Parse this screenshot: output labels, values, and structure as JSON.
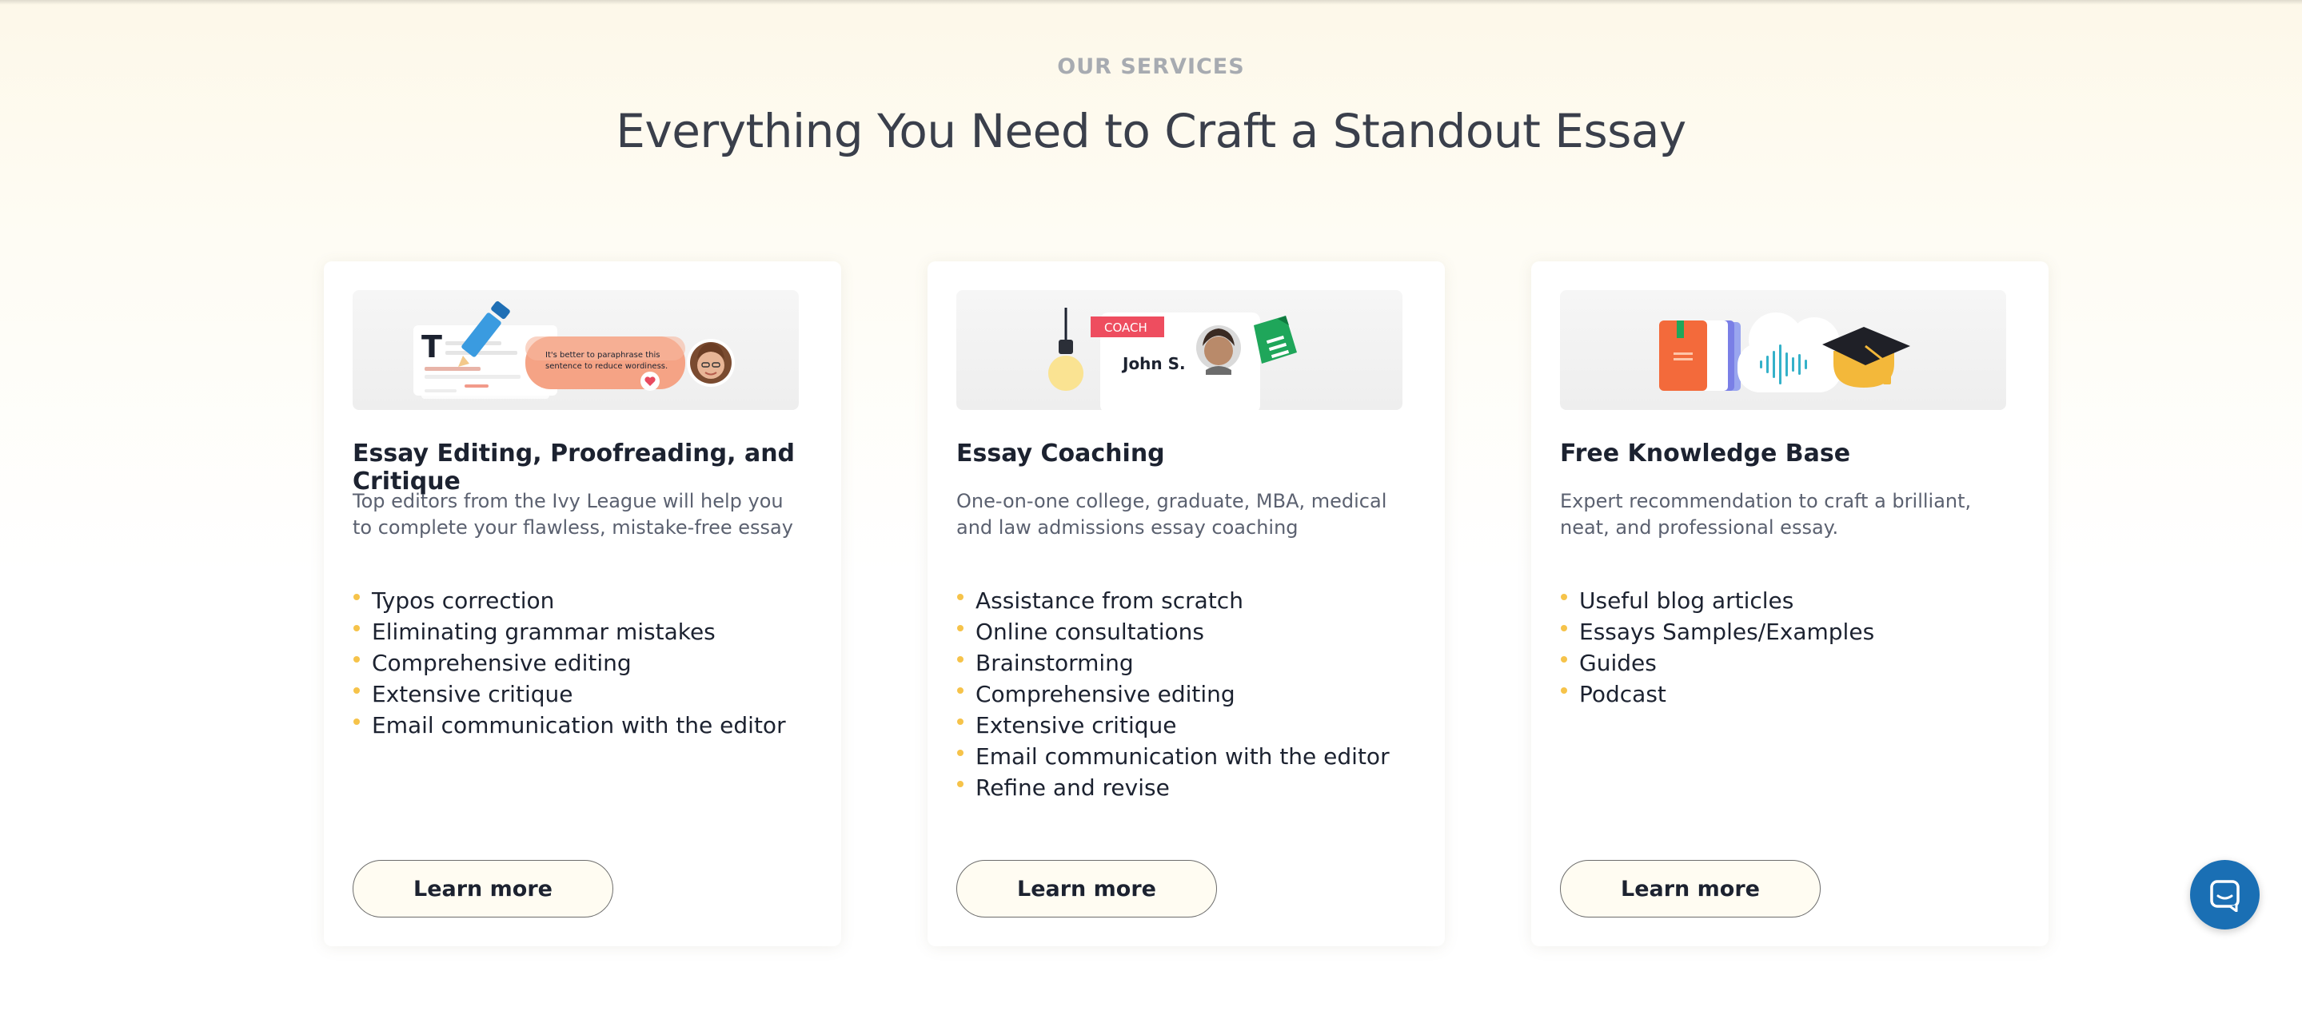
{
  "section": {
    "eyebrow": "OUR SERVICES",
    "title": "Everything You Need to Craft a Standout Essay"
  },
  "cards": [
    {
      "title": "Essay Editing, Proofreading, and Critique",
      "description": "Top editors from the Ivy League will help you to complete your flawless, mistake-free essay",
      "features": [
        "Typos correction",
        "Eliminating grammar mistakes",
        "Comprehensive editing",
        "Extensive critique",
        "Email communication with the editor"
      ],
      "button": "Learn more",
      "illustration": {
        "bubble_text_1": "It's better to paraphrase this",
        "bubble_text_2": "sentence to reduce wordiness.",
        "doc_letter": "T"
      }
    },
    {
      "title": "Essay Coaching",
      "description": "One-on-one college, graduate, MBA, medical and law admissions essay coaching",
      "features": [
        "Assistance from scratch",
        "Online consultations",
        "Brainstorming",
        "Comprehensive editing",
        "Extensive critique",
        "Email communication with the editor",
        "Refine and revise"
      ],
      "button": "Learn more",
      "illustration": {
        "tag": "COACH",
        "name": "John S."
      }
    },
    {
      "title": "Free Knowledge Base",
      "description": "Expert recommendation to craft a brilliant, neat, and professional essay.",
      "features": [
        "Useful blog articles",
        "Essays Samples/Examples",
        "Guides",
        "Podcast"
      ],
      "button": "Learn more"
    }
  ],
  "colors": {
    "accent_bullet": "#f6c34a",
    "chat_button": "#1a6fb4",
    "heading": "#3a3f4b"
  },
  "icons": [
    "chat-icon",
    "pencil-icon",
    "lightbulb-icon",
    "document-icon",
    "book-icon",
    "audio-wave-icon",
    "graduation-cap-icon"
  ]
}
